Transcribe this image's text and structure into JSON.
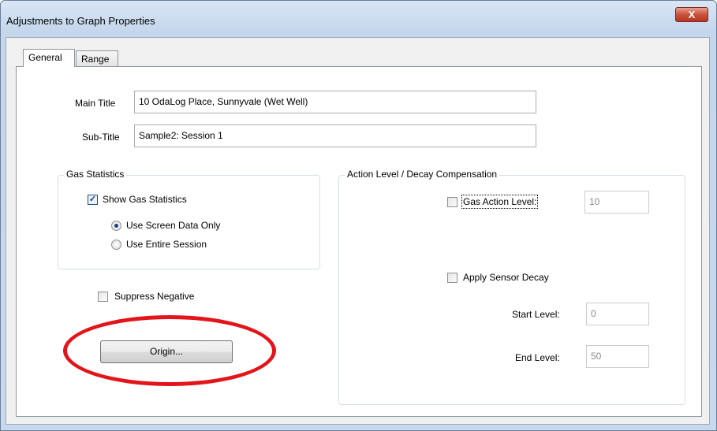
{
  "window": {
    "title": "Adjustments to Graph Properties",
    "close_label": "X"
  },
  "tabs": [
    {
      "label": "General",
      "active": true
    },
    {
      "label": "Range",
      "active": false
    }
  ],
  "general": {
    "main_title_label": "Main Title",
    "main_title_value": "10 OdaLog Place, Sunnyvale (Wet Well)",
    "sub_title_label": "Sub-Title",
    "sub_title_value": "Sample2: Session 1",
    "gas_statistics": {
      "group_label": "Gas Statistics",
      "show_label": "Show Gas Statistics",
      "show_checked": true,
      "option_screen": "Use Screen Data Only",
      "option_session": "Use Entire Session",
      "selected_option": "Use Screen Data Only"
    },
    "suppress_negative_label": "Suppress Negative",
    "suppress_negative_checked": false,
    "origin_button_label": "Origin...",
    "action_level": {
      "group_label": "Action Level / Decay Compensation",
      "gas_action_label": "Gas Action Level:",
      "gas_action_checked": false,
      "gas_action_value": "10",
      "apply_decay_label": "Apply Sensor Decay",
      "apply_decay_checked": false,
      "start_level_label": "Start Level:",
      "start_level_value": "0",
      "end_level_label": "End Level:",
      "end_level_value": "50"
    }
  },
  "colors": {
    "highlight_ellipse": "#e3141a",
    "close_button": "#c9513c"
  }
}
